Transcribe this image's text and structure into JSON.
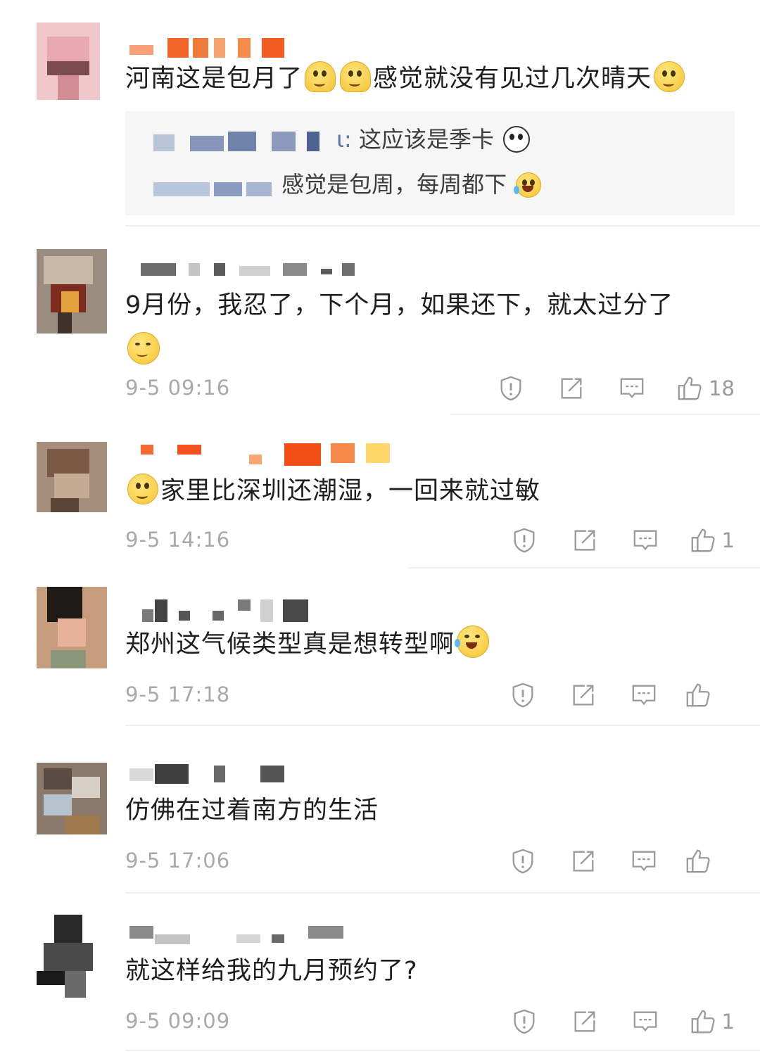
{
  "colors": {
    "text": "#1e1e1e",
    "meta": "#a9a9a9",
    "reply_bg": "#f6f6f6",
    "icon": "#9a9a9a"
  },
  "comments": [
    {
      "text_parts": [
        "河南这是包月了",
        "感觉就没有见过几次晴天"
      ],
      "emojis": [
        "shrug-emoji",
        "shrug-emoji",
        "thinking-emoji"
      ],
      "replies": [
        {
          "author_suffix": "ι:",
          "text": "这应该是季卡"
        },
        {
          "text": "感觉是包周，每周都下"
        }
      ]
    },
    {
      "text": "9月份，我忍了，下个月，如果还下，就太过分了",
      "emoji": "annoyed-emoji",
      "time": "9-5 09:16",
      "likes": "18"
    },
    {
      "text": "家里比深圳还潮湿，一回来就过敏",
      "emoji": "thinking-emoji",
      "time": "9-5 14:16",
      "likes": "1"
    },
    {
      "text": "郑州这气候类型真是想转型啊",
      "emoji": "laughing-tears-emoji",
      "time": "9-5 17:18",
      "likes": ""
    },
    {
      "text": "仿佛在过着南方的生活",
      "time": "9-5 17:06",
      "likes": ""
    },
    {
      "text": "就这样给我的九月预约了?",
      "time": "9-5 09:09",
      "likes": "1"
    }
  ]
}
